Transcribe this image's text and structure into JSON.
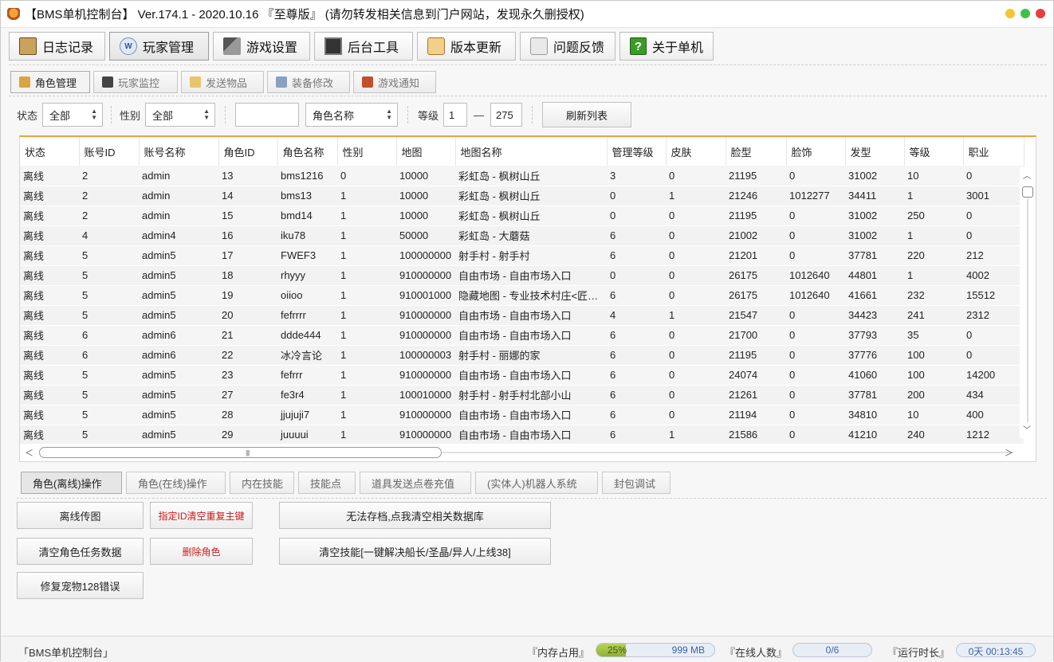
{
  "window": {
    "title": "【BMS单机控制台】 Ver.174.1 - 2020.10.16 『至尊版』 (请勿转发相关信息到门户网站，发现永久删授权)"
  },
  "main_tabs": [
    {
      "label": "日志记录",
      "icon": "book-icon"
    },
    {
      "label": "玩家管理",
      "icon": "user-icon",
      "icon_text": "W"
    },
    {
      "label": "游戏设置",
      "icon": "gun-icon"
    },
    {
      "label": "后台工具",
      "icon": "computer-icon"
    },
    {
      "label": "版本更新",
      "icon": "scroll-icon"
    },
    {
      "label": "问题反馈",
      "icon": "feedback-icon"
    },
    {
      "label": "关于单机",
      "icon": "help-icon",
      "icon_text": "?"
    }
  ],
  "sub_tabs": [
    {
      "label": "角色管理",
      "color": "#d9a441"
    },
    {
      "label": "玩家监控",
      "color": "#444444"
    },
    {
      "label": "发送物品",
      "color": "#e8c46a"
    },
    {
      "label": "装备修改",
      "color": "#8aa0c0"
    },
    {
      "label": "游戏通知",
      "color": "#c0502a"
    }
  ],
  "filters": {
    "state_label": "状态",
    "state_value": "全部",
    "gender_label": "性别",
    "gender_value": "全部",
    "search_value": "",
    "search_field": "角色名称",
    "level_label": "等级",
    "level_min": "1",
    "level_dash": "—",
    "level_max": "275",
    "refresh_label": "刷新列表"
  },
  "table": {
    "columns": [
      "状态",
      "账号ID",
      "账号名称",
      "角色ID",
      "角色名称",
      "性别",
      "地图",
      "地图名称",
      "管理等级",
      "皮肤",
      "脸型",
      "脸饰",
      "发型",
      "等级",
      "职业"
    ],
    "rows": [
      [
        "离线",
        "2",
        "admin",
        "13",
        "bms1216",
        "0",
        "10000",
        "彩虹岛 - 枫树山丘",
        "3",
        "0",
        "21195",
        "0",
        "31002",
        "10",
        "0"
      ],
      [
        "离线",
        "2",
        "admin",
        "14",
        "bms13",
        "1",
        "10000",
        "彩虹岛 - 枫树山丘",
        "0",
        "1",
        "21246",
        "1012277",
        "34411",
        "1",
        "3001"
      ],
      [
        "离线",
        "2",
        "admin",
        "15",
        "bmd14",
        "1",
        "10000",
        "彩虹岛 - 枫树山丘",
        "0",
        "0",
        "21195",
        "0",
        "31002",
        "250",
        "0"
      ],
      [
        "离线",
        "4",
        "admin4",
        "16",
        "iku78",
        "1",
        "50000",
        "彩虹岛 - 大蘑菇",
        "6",
        "0",
        "21002",
        "0",
        "31002",
        "1",
        "0"
      ],
      [
        "离线",
        "5",
        "admin5",
        "17",
        "FWEF3",
        "1",
        "100000000",
        "射手村 - 射手村",
        "6",
        "0",
        "21201",
        "0",
        "37781",
        "220",
        "212"
      ],
      [
        "离线",
        "5",
        "admin5",
        "18",
        "rhyyy",
        "1",
        "910000000",
        "自由市场 - 自由市场入口",
        "0",
        "0",
        "26175",
        "1012640",
        "44801",
        "1",
        "4002"
      ],
      [
        "离线",
        "5",
        "admin5",
        "19",
        "oiioo",
        "1",
        "910001000",
        "隐藏地图 - 专业技术村庄<匠…",
        "6",
        "0",
        "26175",
        "1012640",
        "41661",
        "232",
        "15512"
      ],
      [
        "离线",
        "5",
        "admin5",
        "20",
        "fefrrrr",
        "1",
        "910000000",
        "自由市场 - 自由市场入口",
        "4",
        "1",
        "21547",
        "0",
        "34423",
        "241",
        "2312"
      ],
      [
        "离线",
        "6",
        "admin6",
        "21",
        "ddde444",
        "1",
        "910000000",
        "自由市场 - 自由市场入口",
        "6",
        "0",
        "21700",
        "0",
        "37793",
        "35",
        "0"
      ],
      [
        "离线",
        "6",
        "admin6",
        "22",
        "冰冷言论",
        "1",
        "100000003",
        "射手村 - 丽娜的家",
        "6",
        "0",
        "21195",
        "0",
        "37776",
        "100",
        "0"
      ],
      [
        "离线",
        "5",
        "admin5",
        "23",
        "fefrrr",
        "1",
        "910000000",
        "自由市场 - 自由市场入口",
        "6",
        "0",
        "24074",
        "0",
        "41060",
        "100",
        "14200"
      ],
      [
        "离线",
        "5",
        "admin5",
        "27",
        "fe3r4",
        "1",
        "100010000",
        "射手村 - 射手村北部小山",
        "6",
        "0",
        "21261",
        "0",
        "37781",
        "200",
        "434"
      ],
      [
        "离线",
        "5",
        "admin5",
        "28",
        "jjujuji7",
        "1",
        "910000000",
        "自由市场 - 自由市场入口",
        "6",
        "0",
        "21194",
        "0",
        "34810",
        "10",
        "400"
      ],
      [
        "离线",
        "5",
        "admin5",
        "29",
        "juuuui",
        "1",
        "910000000",
        "自由市场 - 自由市场入口",
        "6",
        "1",
        "21586",
        "0",
        "41210",
        "240",
        "1212"
      ]
    ]
  },
  "op_tabs": [
    "角色(离线)操作",
    "角色(在线)操作",
    "内在技能",
    "技能点",
    "道具发送点卷充值",
    "(实体人)机器人系统",
    "封包调试"
  ],
  "actions": {
    "offline_teleport": "离线传图",
    "clear_duplicate_key": "指定ID清空重复主键",
    "clear_db": "无法存档,点我清空相关数据库",
    "clear_quest": "清空角色任务数据",
    "delete_char": "删除角色",
    "clear_skills": "清空技能[一键解决船长/圣晶/异人/上线38]",
    "fix_pet": "修复宠物128错误"
  },
  "status": {
    "app_name": "「BMS单机控制台」",
    "mem_label": "『内存占用』",
    "mem_pct_text": "25%",
    "mem_fill_fraction": 0.25,
    "mem_value": "999 MB",
    "online_label": "『在线人数』",
    "online_value": "0/6",
    "uptime_label": "『运行时长』",
    "uptime_value": "0天 00:13:45"
  },
  "colors": {
    "table_accent": "#f0a040",
    "danger_text": "#d21a1a",
    "memory_fill": "#8fb132"
  }
}
